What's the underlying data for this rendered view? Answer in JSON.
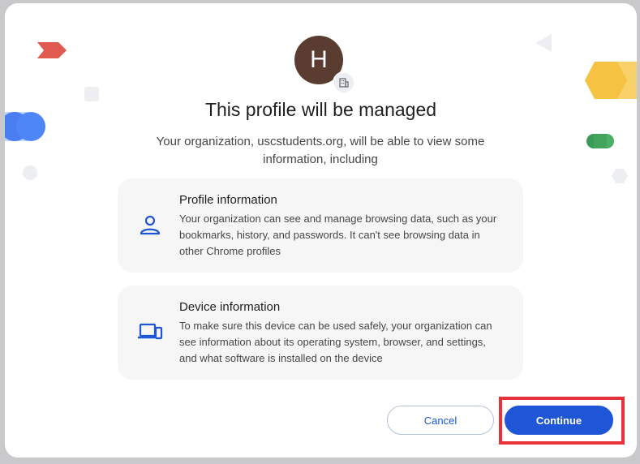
{
  "dialog": {
    "avatar_letter": "H",
    "badge_icon": "building-icon",
    "title": "This profile will be managed",
    "subtitle": "Your organization, uscstudents.org, will be able to view some information, including"
  },
  "cards": [
    {
      "icon": "person-icon",
      "heading": "Profile information",
      "body": "Your organization can see and manage browsing data, such as your bookmarks, history, and passwords. It can't see browsing data in other Chrome profiles"
    },
    {
      "icon": "devices-icon",
      "heading": "Device information",
      "body": "To make sure this device can be used safely, your organization can see information about its operating system, browser, and settings, and what software is installed on the device"
    }
  ],
  "buttons": {
    "cancel": "Cancel",
    "continue": "Continue"
  },
  "colors": {
    "accent": "#1f56d8",
    "avatar": "#5b3c30",
    "highlight": "#e8323a"
  }
}
